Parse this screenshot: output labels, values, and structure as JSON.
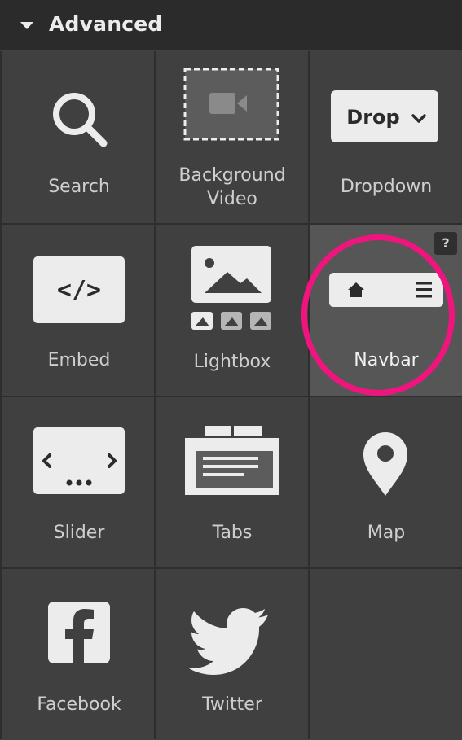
{
  "panel": {
    "title": "Advanced",
    "colors": {
      "background": "#404040",
      "header": "#2b2b2b",
      "active_tile": "#565656",
      "highlight_ring": "#f0157e",
      "icon_fill": "#ececec"
    }
  },
  "tiles": [
    {
      "label": "Search",
      "icon": "search-icon"
    },
    {
      "label_line1": "Background",
      "label_line2": "Video",
      "icon": "background-video-icon"
    },
    {
      "label": "Dropdown",
      "icon": "dropdown-icon",
      "button_text": "Drop"
    },
    {
      "label": "Embed",
      "icon": "embed-code-icon",
      "code_text": "</>"
    },
    {
      "label": "Lightbox",
      "icon": "lightbox-icon"
    },
    {
      "label": "Navbar",
      "icon": "navbar-icon",
      "help": "?",
      "active": true
    },
    {
      "label": "Slider",
      "icon": "slider-icon"
    },
    {
      "label": "Tabs",
      "icon": "tabs-icon"
    },
    {
      "label": "Map",
      "icon": "map-pin-icon"
    },
    {
      "label": "Facebook",
      "icon": "facebook-icon"
    },
    {
      "label": "Twitter",
      "icon": "twitter-icon"
    }
  ]
}
